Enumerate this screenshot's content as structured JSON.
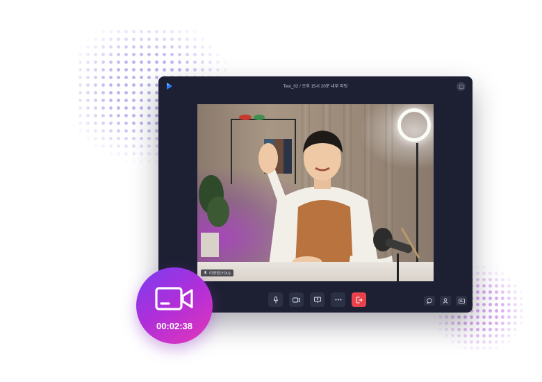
{
  "window": {
    "title": "Test_02 / 오후 15시 20분 내부 미팅"
  },
  "video": {
    "participant_name": "이영찬(YOU)"
  },
  "controls": {
    "main": [
      "mic-icon",
      "camera-icon",
      "share-screen-icon",
      "more-icon",
      "leave-icon"
    ],
    "right": [
      "chat-icon",
      "participants-icon",
      "caption-icon"
    ]
  },
  "recording": {
    "elapsed": "00:02:38"
  },
  "colors": {
    "window_bg": "#1d2033",
    "button_bg": "#2c3044",
    "leave": "#e8424c",
    "badge_gradient_start": "#7a3cf0",
    "badge_gradient_end": "#e436b8"
  }
}
